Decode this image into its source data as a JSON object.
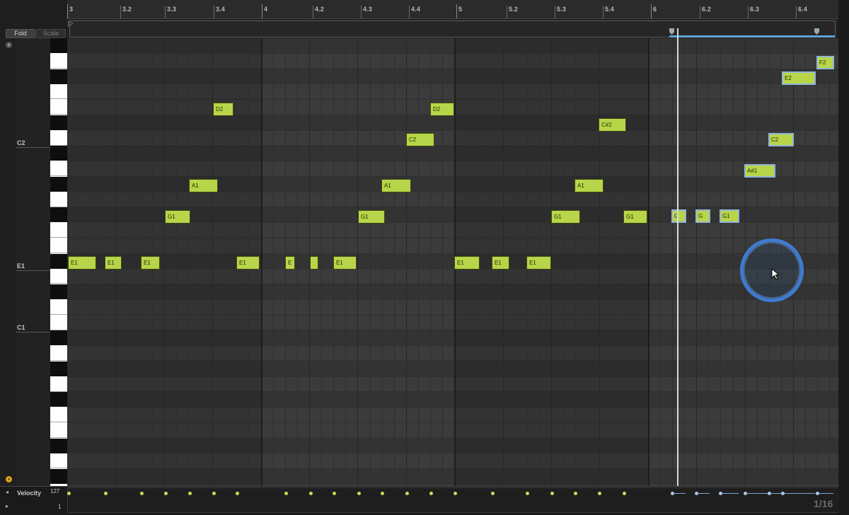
{
  "ruler": {
    "ticks": [
      "3",
      "3.2",
      "3.3",
      "3.4",
      "4",
      "4.2",
      "4.3",
      "4.4",
      "5",
      "5.2",
      "5.3",
      "5.4",
      "6",
      "6.2",
      "6.3",
      "6.4"
    ]
  },
  "header": {
    "fold_label": "Fold",
    "scale_label": "Scale"
  },
  "pitch_labels": {
    "c2": "C2",
    "e1": "E1",
    "c1": "C1"
  },
  "notes": [
    "E1",
    "E1",
    "E1",
    "G1",
    "A1",
    "D2",
    "E1",
    "E",
    "",
    "E1",
    "G1",
    "A1",
    "C2",
    "D2",
    "E1",
    "E1",
    "E1",
    "G1",
    "A1",
    "C#2",
    "G1",
    "G",
    "G",
    "G1",
    "A#1",
    "C2",
    "E2",
    "F2"
  ],
  "velocity": {
    "label": "Velocity",
    "max": "127",
    "min": "1"
  },
  "grid_setting": "1/16",
  "colors": {
    "note_fill": "#b8d54a",
    "selection_outline": "#8fb4d9",
    "playhead": "#d9d9d9",
    "cursor_ring": "#3e7bd0"
  },
  "icons": {
    "zoom": "plus-circle-icon",
    "loop_start": "triangle-right-icon",
    "record": "orange-circle-icon",
    "cursor": "arrow-pointer-icon"
  }
}
